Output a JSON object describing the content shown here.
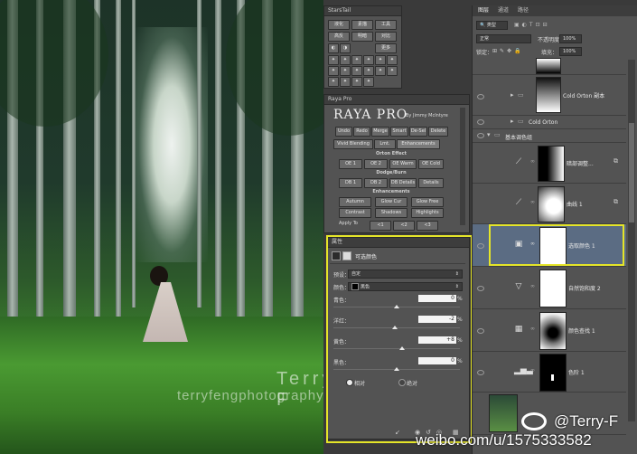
{
  "photo": {
    "watermark_name": "Terry  F",
    "watermark_site": "terryfengphotography.lofter.com"
  },
  "starstail": {
    "title": "StarsTail",
    "row1": [
      "液化",
      "素描",
      "工具"
    ],
    "row2": [
      "高反",
      "明暗",
      "对比"
    ],
    "more": "更多"
  },
  "raya": {
    "title": "Raya Pro",
    "logo": "RAYA PRO",
    "byline": "By Jimmy McIntyre",
    "row1": [
      "Undo",
      "Redo",
      "Merge",
      "Smart",
      "De-Sel",
      "Delete"
    ],
    "tabs": [
      "Vivid Blending",
      "Lmt.",
      "Enhancements"
    ],
    "sec_orton": "Orton Effect",
    "orton": [
      "OE 1",
      "OE 2",
      "OE Warm",
      "OE Cold"
    ],
    "sec_dodge": "Dodge/Burn",
    "dodge": [
      "DB 1",
      "DB 2",
      "DB Details",
      "Details"
    ],
    "sec_enh": "Enhancements",
    "enh1": [
      "Autumn",
      "Glow Cur",
      "Glow Free"
    ],
    "enh2": [
      "Contrast",
      "Shadows",
      "Highlights"
    ],
    "apply": "Apply To",
    "apply_btns": [
      "<1",
      "<2",
      "<3"
    ]
  },
  "properties": {
    "title": "属性",
    "adj_name": "可选颜色",
    "preset_label": "预设：",
    "preset_value": "自定",
    "colors_label": "颜色：",
    "colors_value": "黑色",
    "sliders": [
      {
        "label": "青色：",
        "value": "0"
      },
      {
        "label": "洋红：",
        "value": "-2"
      },
      {
        "label": "黄色：",
        "value": "+8"
      },
      {
        "label": "黑色：",
        "value": "0"
      }
    ],
    "pct": "%",
    "relative": "相对",
    "absolute": "绝对"
  },
  "layers": {
    "tabs": [
      "图层",
      "通道",
      "路径"
    ],
    "kind_label": "类型",
    "blend_mode": "正常",
    "opacity_label": "不透明度：",
    "opacity_value": "100%",
    "lock_label": "锁定：",
    "fill_label": "填充：",
    "fill_value": "100%",
    "items": [
      {
        "name": "Cold Orton 副本"
      },
      {
        "name": "Cold Orton"
      },
      {
        "name": "基本调色组"
      },
      {
        "name": "暗部调整..."
      },
      {
        "name": "曲线 1"
      },
      {
        "name": "选取颜色 1"
      },
      {
        "name": "自然饱和度 2"
      },
      {
        "name": "颜色查找 1"
      },
      {
        "name": "色阶 1"
      }
    ]
  },
  "weibo": {
    "handle": "@Terry-F",
    "url": "weibo.com/u/1575333582"
  },
  "colors": {
    "highlight": "#e5e529",
    "panel": "#535353",
    "selected_layer": "#5b6c83"
  }
}
